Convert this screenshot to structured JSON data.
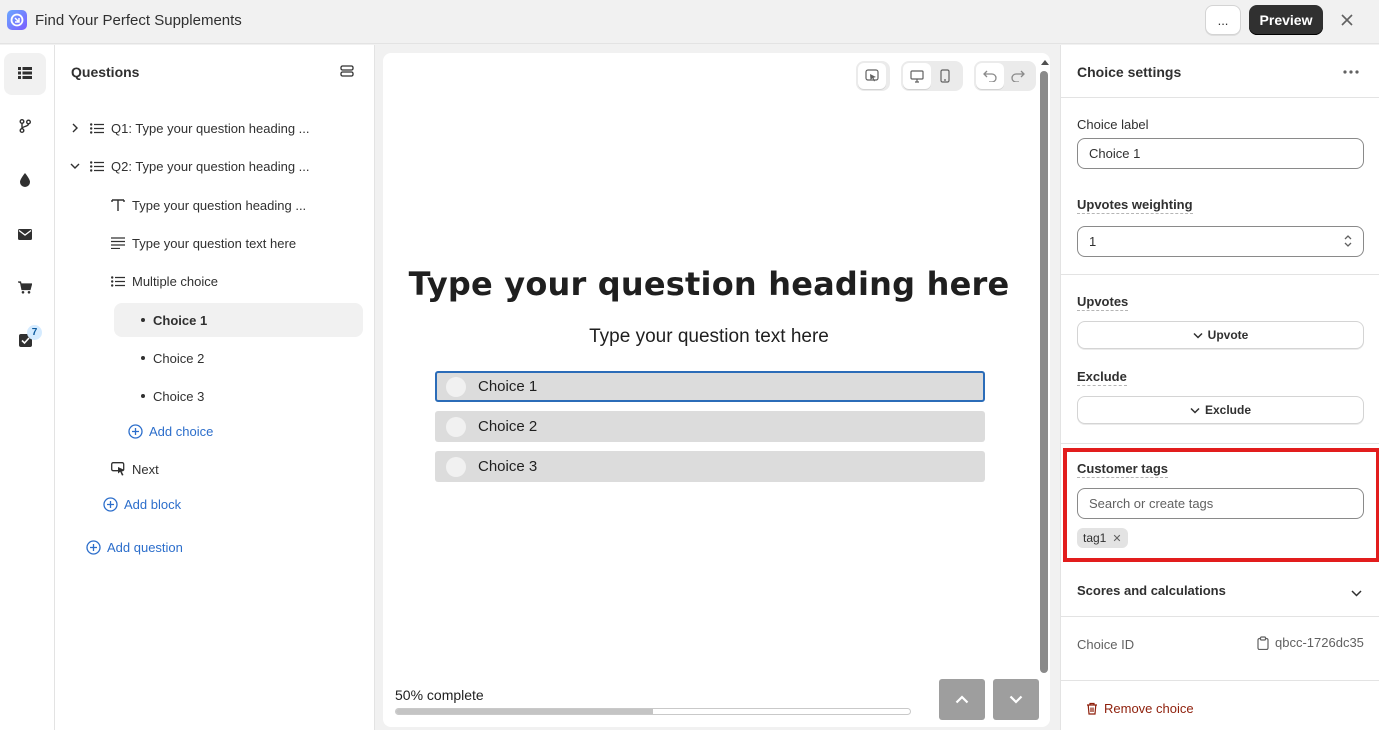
{
  "app": {
    "title": "Find Your Perfect Supplements",
    "more_label": "...",
    "preview_label": "Preview",
    "close_icon": "close-icon"
  },
  "rail": {
    "items": [
      {
        "icon": "list-icon",
        "active": true
      },
      {
        "icon": "branch-icon",
        "active": false
      },
      {
        "icon": "drop-icon",
        "active": false
      },
      {
        "icon": "email-icon",
        "active": false
      },
      {
        "icon": "cart-icon",
        "active": false
      },
      {
        "icon": "checklist-icon",
        "active": false,
        "badge": "7"
      }
    ]
  },
  "questions": {
    "title": "Questions",
    "q1": "Q1: Type your question heading ...",
    "q2": "Q2: Type your question heading ...",
    "q2_heading": "Type your question heading ...",
    "q2_text": "Type your question text here",
    "q2_multiple": "Multiple choice",
    "choices": [
      "Choice 1",
      "Choice 2",
      "Choice 3"
    ],
    "add_choice": "Add choice",
    "next": "Next",
    "add_block": "Add block",
    "add_question": "Add question"
  },
  "preview": {
    "heading": "Type your question heading here",
    "text": "Type your question text here",
    "choices": [
      "Choice 1",
      "Choice 2",
      "Choice 3"
    ],
    "selected_choice": "Choice 1",
    "progress_label": "50% complete",
    "progress": 0.5
  },
  "settings": {
    "title": "Choice settings",
    "choice_label_title": "Choice label",
    "choice_label_value": "Choice 1",
    "upvotes_weighting_title": "Upvotes weighting",
    "upvotes_weighting_value": "1",
    "upvotes_title": "Upvotes",
    "upvote_button": "Upvote",
    "exclude_title": "Exclude",
    "exclude_button": "Exclude",
    "customer_tags_title": "Customer tags",
    "tags_placeholder": "Search or create tags",
    "tags": [
      "tag1"
    ],
    "scores_title": "Scores and calculations",
    "choice_id_label": "Choice ID",
    "choice_id_value": "qbcc-1726dc35",
    "remove_choice": "Remove choice"
  },
  "colors": {
    "highlight": "#e21d1d",
    "link": "#2c6ecb",
    "danger": "#8e1f0b",
    "selected_border": "#2b6cb8"
  }
}
